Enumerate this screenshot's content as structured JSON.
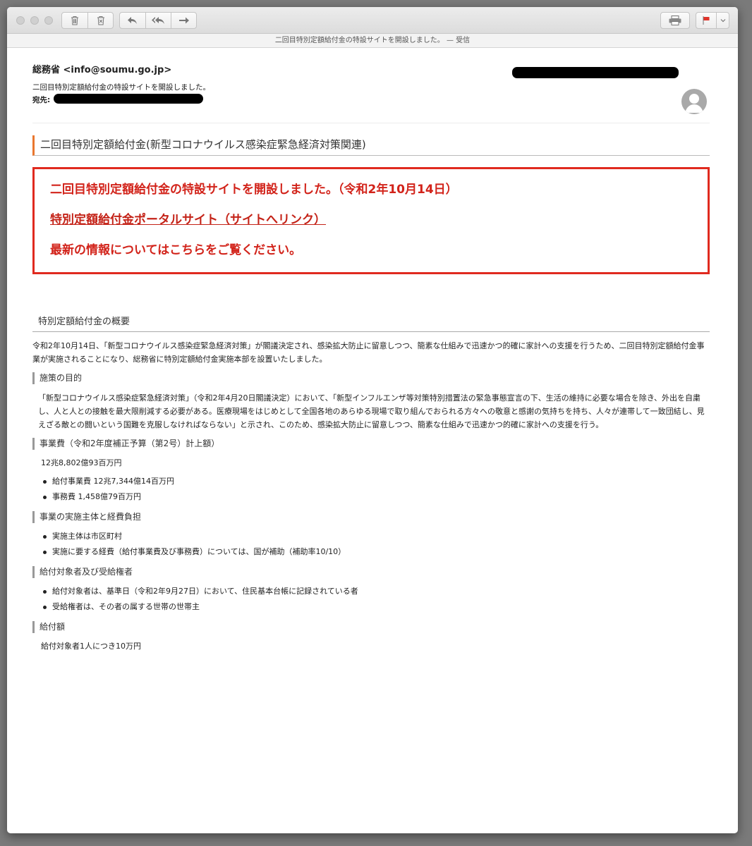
{
  "window": {
    "title": "二回目特別定額給付金の特設サイトを開設しました。 — 受信"
  },
  "toolbar": {
    "icons": [
      "trash-icon",
      "junk-icon",
      "reply-icon",
      "reply-all-icon",
      "forward-icon",
      "print-icon",
      "flag-icon",
      "chevron-down-icon"
    ],
    "flag_color": "#e0332a"
  },
  "header": {
    "from": "総務省 <info@soumu.go.jp>",
    "subject": "二回目特別定額給付金の特設サイトを開設しました。",
    "to_label": "宛先:"
  },
  "content": {
    "section_title": "二回目特別定額給付金(新型コロナウイルス感染症緊急経済対策関連)",
    "notice": {
      "line1": "二回目特別定額給付金の特設サイトを開設しました。（令和2年10月14日）",
      "link": "特別定額給付金ポータルサイト（サイトへリンク）",
      "line3": "最新の情報についてはこちらをご覧ください。",
      "border_color": "#e02a1f",
      "text_color": "#d2231a"
    },
    "overview_title": "特別定額給付金の概要",
    "overview_text": "令和2年10月14日、「新型コロナウイルス感染症緊急経済対策」が閣議決定され、感染拡大防止に留意しつつ、簡素な仕組みで迅速かつ的確に家計への支援を行うため、二回目特別定額給付金事業が実施されることになり、総務省に特別定額給付金実施本部を設置いたしました。",
    "purpose_title": "施策の目的",
    "purpose_text": "「新型コロナウイルス感染症緊急経済対策」（令和2年4月20日閣議決定）において、「新型インフルエンザ等対策特別措置法の緊急事態宣言の下、生活の維持に必要な場合を除き、外出を自粛し、人と人との接触を最大限削減する必要がある。医療現場をはじめとして全国各地のあらゆる現場で取り組んでおられる方々への敬意と感謝の気持ちを持ち、人々が連帯して一致団結し、見えざる敵との闘いという国難を克服しなければならない」と示され、このため、感染拡大防止に留意しつつ、簡素な仕組みで迅速かつ的確に家計への支援を行う。",
    "budget_title": "事業費（令和2年度補正予算（第2号）計上額）",
    "budget_amount": "12兆8,802億93百万円",
    "budget_items": [
      "給付事業費 12兆7,344億14百万円",
      "事務費 1,458億79百万円"
    ],
    "entity_title": "事業の実施主体と経費負担",
    "entity_items": [
      "実施主体は市区町村",
      "実施に要する経費（給付事業費及び事務費）については、国が補助（補助率10/10）"
    ],
    "target_title": "給付対象者及び受給権者",
    "target_items": [
      "給付対象者は、基準日（令和2年9月27日）において、住民基本台帳に記録されている者",
      "受給権者は、その者の属する世帯の世帯主"
    ],
    "amount_title": "給付額",
    "amount_text": "給付対象者1人につき10万円"
  }
}
